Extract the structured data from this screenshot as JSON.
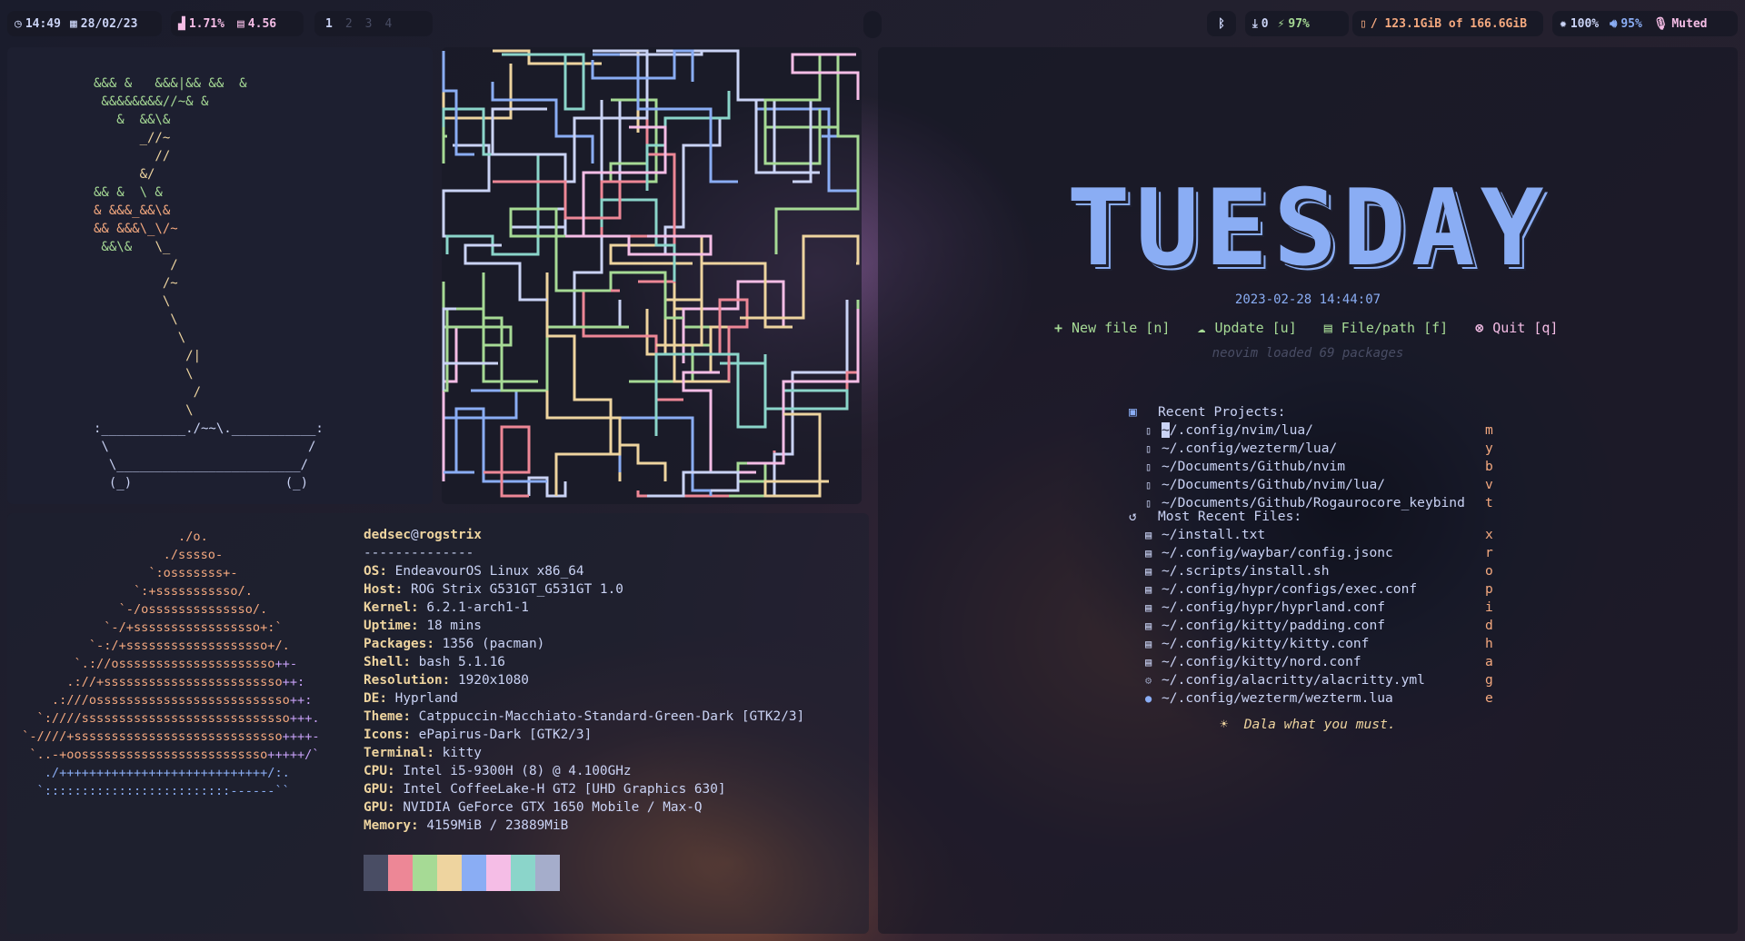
{
  "bar": {
    "time": "14:49",
    "date": "28/02/23",
    "cpu": "1.71%",
    "mem": "4.56",
    "workspaces": [
      "1",
      "2",
      "3",
      "4"
    ],
    "active_workspace": "1",
    "bluetooth_icon": "bluetooth-icon",
    "downloads": "0",
    "battery": "97%",
    "disk": "/ 123.1GiB of 166.6GiB",
    "brightness": "100%",
    "volume": "95%",
    "mic": "Muted"
  },
  "fetch": {
    "user": "dedsec",
    "at": "@",
    "host": "rogstrix",
    "separator": "--------------",
    "rows": [
      {
        "k": "OS",
        "v": "EndeavourOS Linux x86_64"
      },
      {
        "k": "Host",
        "v": "ROG Strix G531GT_G531GT 1.0"
      },
      {
        "k": "Kernel",
        "v": "6.2.1-arch1-1"
      },
      {
        "k": "Uptime",
        "v": "18 mins"
      },
      {
        "k": "Packages",
        "v": "1356 (pacman)"
      },
      {
        "k": "Shell",
        "v": "bash 5.1.16"
      },
      {
        "k": "Resolution",
        "v": "1920x1080"
      },
      {
        "k": "DE",
        "v": "Hyprland"
      },
      {
        "k": "Theme",
        "v": "Catppuccin-Macchiato-Standard-Green-Dark [GTK2/3]"
      },
      {
        "k": "Icons",
        "v": "ePapirus-Dark [GTK2/3]"
      },
      {
        "k": "Terminal",
        "v": "kitty"
      },
      {
        "k": "CPU",
        "v": "Intel i5-9300H (8) @ 4.100GHz"
      },
      {
        "k": "GPU",
        "v": "Intel CoffeeLake-H GT2 [UHD Graphics 630]"
      },
      {
        "k": "GPU",
        "v": "NVIDIA GeForce GTX 1650 Mobile / Max-Q"
      },
      {
        "k": "Memory",
        "v": "4159MiB / 23889MiB"
      }
    ],
    "palette": [
      "#494d64",
      "#ed8796",
      "#a6da95",
      "#eed49f",
      "#8aadf4",
      "#f5bde6",
      "#8bd5ca",
      "#a5adcb"
    ]
  },
  "dashboard": {
    "day": "TUESDAY",
    "datetime": "2023-02-28 14:44:07",
    "actions": [
      {
        "icon": "+",
        "label": "New file [n]"
      },
      {
        "icon": "☁",
        "label": "Update [u]"
      },
      {
        "icon": "▤",
        "label": "File/path [f]"
      },
      {
        "icon": "⊗",
        "label": "Quit [q]"
      }
    ],
    "loaded": "neovim loaded 69 packages",
    "recent_projects_title": "Recent Projects:",
    "projects": [
      {
        "path": "~/.config/nvim/lua/",
        "key": "m"
      },
      {
        "path": "~/.config/wezterm/lua/",
        "key": "y"
      },
      {
        "path": "~/Documents/Github/nvim",
        "key": "b"
      },
      {
        "path": "~/Documents/Github/nvim/lua/",
        "key": "v"
      },
      {
        "path": "~/Documents/Github/Rogaurocore_keybind",
        "key": "t"
      }
    ],
    "recent_files_title": "Most Recent Files:",
    "files": [
      {
        "path": "~/install.txt",
        "key": "x"
      },
      {
        "path": "~/.config/waybar/config.jsonc",
        "key": "r"
      },
      {
        "path": "~/.scripts/install.sh",
        "key": "o"
      },
      {
        "path": "~/.config/hypr/configs/exec.conf",
        "key": "p"
      },
      {
        "path": "~/.config/hypr/hyprland.conf",
        "key": "i"
      },
      {
        "path": "~/.config/kitty/padding.conf",
        "key": "d"
      },
      {
        "path": "~/.config/kitty/kitty.conf",
        "key": "h"
      },
      {
        "path": "~/.config/kitty/nord.conf",
        "key": "a"
      },
      {
        "path": "~/.config/alacritty/alacritty.yml",
        "key": "g"
      },
      {
        "path": "~/.config/wezterm/wezterm.lua",
        "key": "e"
      }
    ],
    "quote": "Dala what you must."
  }
}
